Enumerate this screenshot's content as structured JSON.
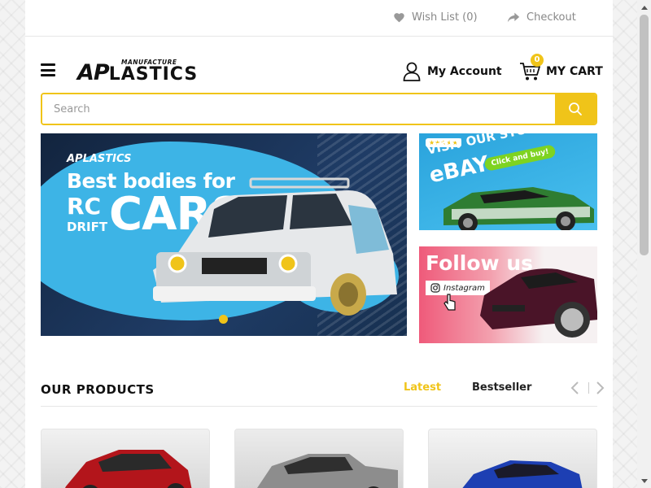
{
  "topbar": {
    "wishlist_label": "Wish List (0)",
    "checkout_label": "Checkout"
  },
  "header": {
    "logo_small": "MANUFACTURE",
    "logo_ap": "AP",
    "logo_main": "LASTICS",
    "account_label": "My Account",
    "cart_label": "MY CART",
    "cart_count": "0"
  },
  "search": {
    "placeholder": "Search"
  },
  "hero": {
    "logo": "APLASTICS",
    "line1": "Best bodies for",
    "rc": "RC",
    "drift": "DRIFT",
    "cars": "CARS"
  },
  "banners": {
    "ebay_line1": "VISIT OUR STORE",
    "ebay_line2": "eBAY",
    "ebay_button": "Click and buy!",
    "ebay_stars": "★★★★★",
    "insta_line1": "Follow us",
    "insta_tag": "Instagram"
  },
  "products": {
    "title": "OUR PRODUCTS",
    "tabs": [
      "Latest",
      "Bestseller"
    ]
  },
  "colors": {
    "accent": "#f0c419",
    "text": "#222222"
  }
}
